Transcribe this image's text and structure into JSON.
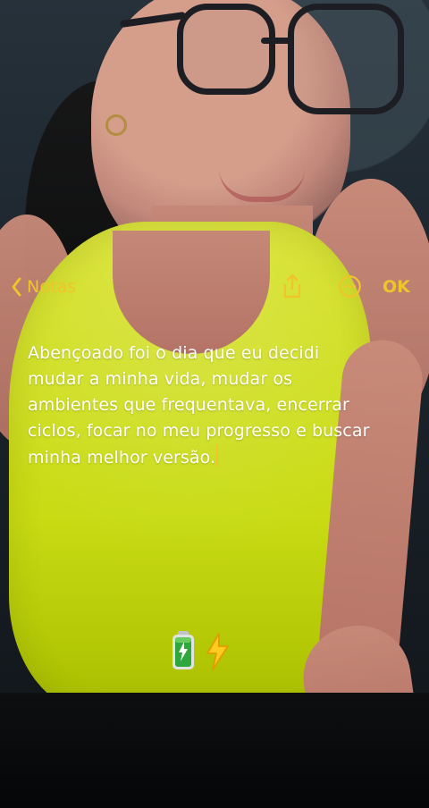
{
  "nav": {
    "back_label": "Notas",
    "ok_label": "OK"
  },
  "note": {
    "text": "Abençoado foi o dia que eu decidi mudar a minha vida, mudar os ambientes que frequentava, encerrar ciclos, focar no meu progresso e buscar minha melhor versão."
  },
  "icons": {
    "back": "chevron-left-icon",
    "share": "share-icon",
    "more": "ellipsis-circle-icon",
    "battery": "battery-icon",
    "lightning": "lightning-icon"
  },
  "colors": {
    "accent": "#f0c42a",
    "text": "#ffffff"
  }
}
